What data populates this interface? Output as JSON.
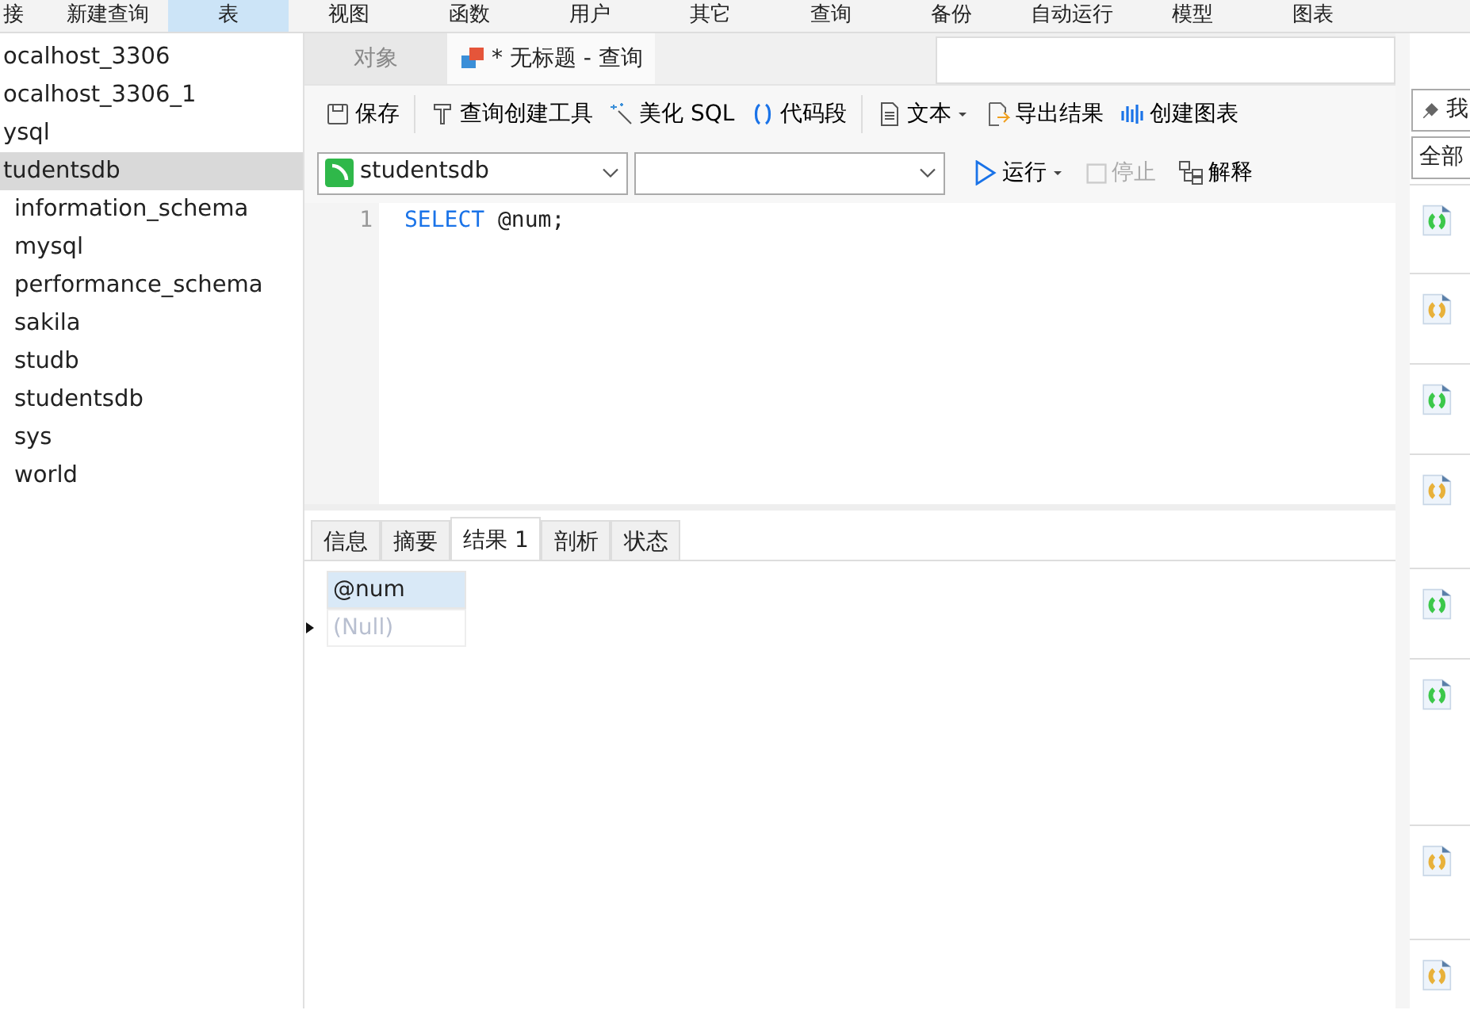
{
  "menu_bar": {
    "items": [
      {
        "label": "接",
        "selected": false
      },
      {
        "label": "新建查询",
        "selected": false
      },
      {
        "label": "表",
        "selected": true
      },
      {
        "label": "视图",
        "selected": false
      },
      {
        "label": "函数",
        "selected": false
      },
      {
        "label": "用户",
        "selected": false
      },
      {
        "label": "其它",
        "selected": false
      },
      {
        "label": "查询",
        "selected": false
      },
      {
        "label": "备份",
        "selected": false
      },
      {
        "label": "自动运行",
        "selected": false
      },
      {
        "label": "模型",
        "selected": false
      },
      {
        "label": "图表",
        "selected": false
      }
    ]
  },
  "sidebar": {
    "items": [
      {
        "label": "ocalhost_3306",
        "selected": false
      },
      {
        "label": "ocalhost_3306_1",
        "selected": false
      },
      {
        "label": "ysql",
        "selected": false
      },
      {
        "label": "tudentsdb",
        "selected": true,
        "children": [
          {
            "label": "information_schema",
            "selected": false
          },
          {
            "label": "mysql",
            "selected": false
          },
          {
            "label": "performance_schema",
            "selected": false
          },
          {
            "label": "sakila",
            "selected": false
          },
          {
            "label": "studb",
            "selected": false
          },
          {
            "label": "studentsdb",
            "selected": false
          },
          {
            "label": "sys",
            "selected": false
          },
          {
            "label": "world",
            "selected": false
          }
        ]
      }
    ]
  },
  "editor_tabs": [
    {
      "label": "对象",
      "selected": false,
      "kind": "plain"
    },
    {
      "label": "* 无标题 - 查询",
      "selected": true,
      "kind": "query"
    }
  ],
  "toolbar": [
    {
      "label": "保存",
      "kind": "save"
    },
    {
      "kind": "sep"
    },
    {
      "label": "查询创建工具",
      "kind": "builder"
    },
    {
      "label": "美化 SQL",
      "kind": "beautify"
    },
    {
      "label": "代码段",
      "kind": "snippet"
    },
    {
      "kind": "sep"
    },
    {
      "label": "文本",
      "kind": "text"
    },
    {
      "label": "导出结果",
      "kind": "export"
    },
    {
      "label": "创建图表",
      "kind": "chart"
    }
  ],
  "query_bar": {
    "database": "studentsdb",
    "run": "运行",
    "stop": "停止",
    "stop_disabled": true,
    "explain": "解释"
  },
  "editor": {
    "lines": [
      {
        "number": "1",
        "keyword": "SELECT",
        "rest": " @num;"
      }
    ]
  },
  "result_tabs": [
    {
      "label": "信息",
      "selected": false
    },
    {
      "label": "摘要",
      "selected": false
    },
    {
      "label": "结果 1",
      "selected": true
    },
    {
      "label": "剖析",
      "selected": false
    },
    {
      "label": "状态",
      "selected": false
    }
  ],
  "result_grid": {
    "columns": [
      "@num"
    ],
    "rows": [
      {
        "current": true,
        "cells": [
          {
            "text": "(Null)",
            "null": true
          }
        ]
      }
    ]
  },
  "right_panel": {
    "button": "我",
    "filter": "全部",
    "items": [
      {
        "color": "#3cc84a"
      },
      {
        "color": "#e8b13a"
      },
      {
        "color": "#3cc84a"
      },
      {
        "color": "#e8b13a"
      },
      {
        "color": "#3cc84a"
      },
      {
        "color": "#3cc84a"
      },
      {
        "color": "#e8b13a"
      },
      {
        "color": "#e8b13a"
      }
    ]
  }
}
